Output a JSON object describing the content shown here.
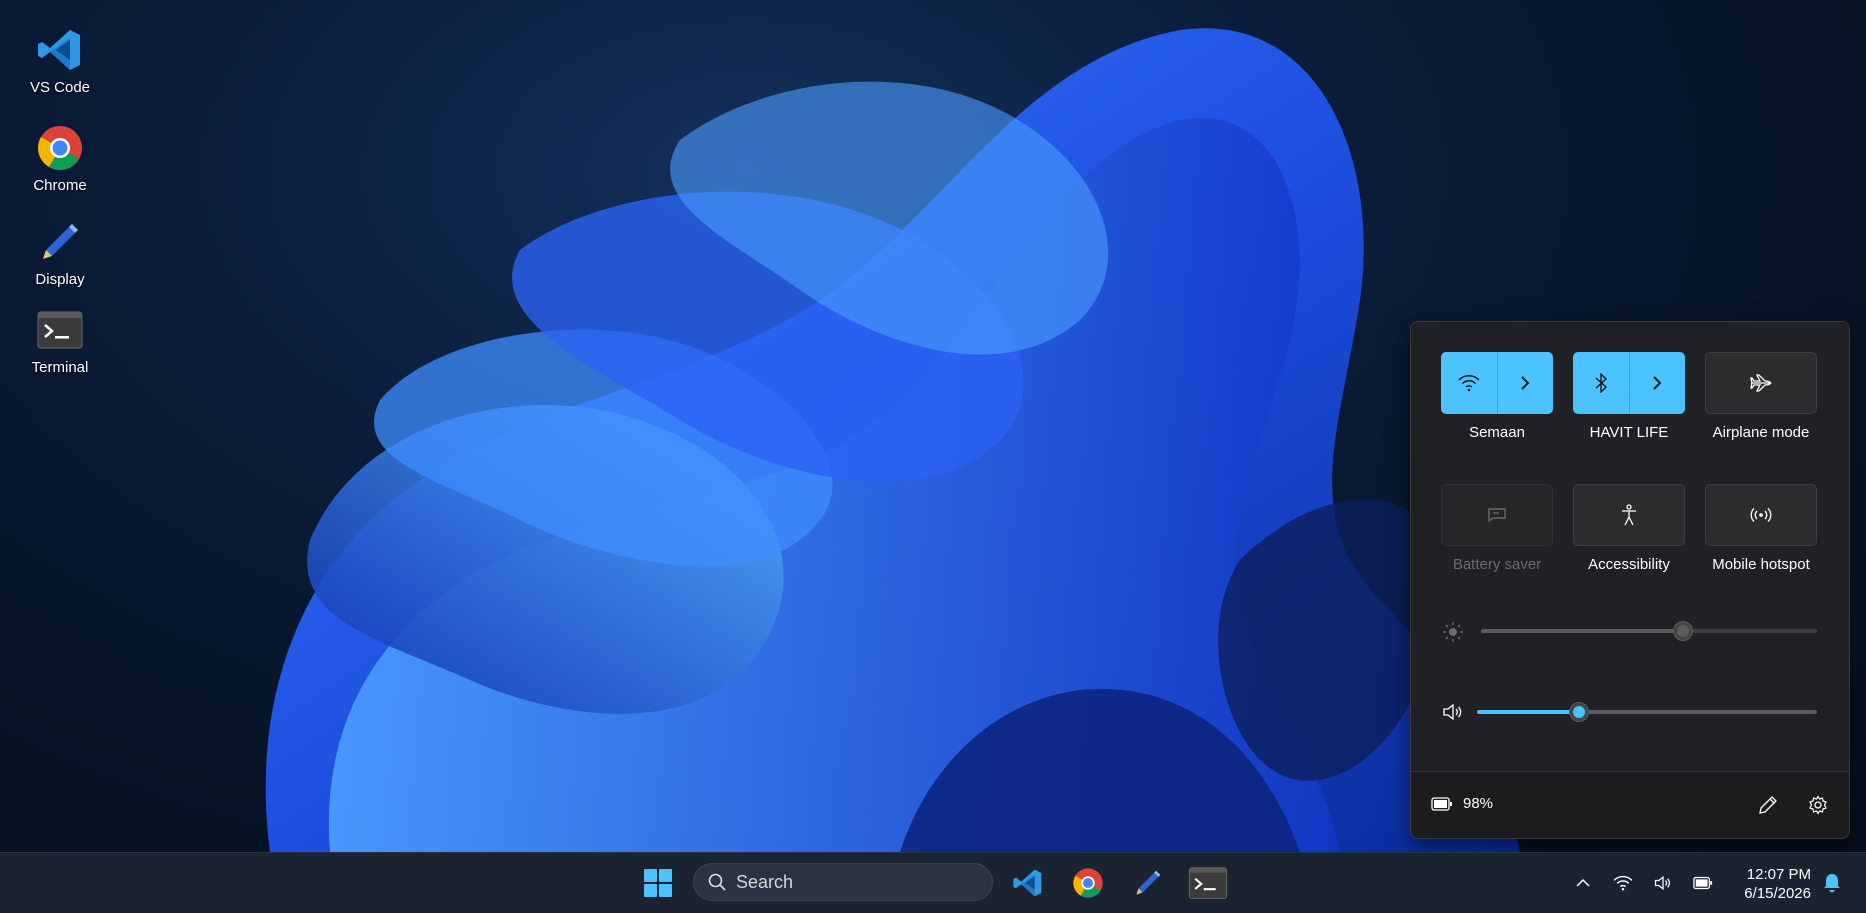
{
  "desktop": {
    "icons": [
      {
        "label": "VS Code",
        "icon": "vscode-icon"
      },
      {
        "label": "Chrome",
        "icon": "chrome-icon"
      },
      {
        "label": "Display",
        "icon": "pen-icon"
      },
      {
        "label": "Terminal",
        "icon": "terminal-icon"
      }
    ]
  },
  "quick_settings": {
    "tiles": [
      {
        "label": "Semaan",
        "icon": "wifi-icon",
        "state": "on",
        "expandable": true
      },
      {
        "label": "HAVIT LIFE",
        "icon": "bluetooth-icon",
        "state": "on",
        "expandable": true
      },
      {
        "label": "Airplane mode",
        "icon": "airplane-icon",
        "state": "off",
        "expandable": false
      },
      {
        "label": "Battery saver",
        "icon": "battery-saver-icon",
        "state": "disabled",
        "expandable": false
      },
      {
        "label": "Accessibility",
        "icon": "accessibility-icon",
        "state": "off",
        "expandable": false
      },
      {
        "label": "Mobile hotspot",
        "icon": "hotspot-icon",
        "state": "off",
        "expandable": false
      }
    ],
    "brightness": {
      "icon": "brightness-icon",
      "level": 0.6,
      "enabled": false
    },
    "volume": {
      "icon": "volume-icon",
      "level": 0.3
    },
    "footer": {
      "battery_icon": "battery-icon",
      "battery_text": "98%",
      "edit_icon": "pencil-icon",
      "settings_icon": "gear-icon"
    }
  },
  "taskbar": {
    "start_icon": "windows-start-icon",
    "search": {
      "placeholder": "Search",
      "icon": "search-icon"
    },
    "pinned": [
      "vscode-icon",
      "chrome-icon",
      "pen-icon",
      "terminal-icon"
    ],
    "tray": [
      "chevron-up-icon",
      "wifi-icon",
      "volume-icon",
      "battery-icon"
    ],
    "clock": {
      "time": "12:07 PM",
      "date": "6/15/2026"
    },
    "notification_icon": "bell-icon"
  },
  "colors": {
    "accent": "#4cc2ff",
    "flyout_bg": "#202124",
    "taskbar_bg": "#1b2230"
  }
}
